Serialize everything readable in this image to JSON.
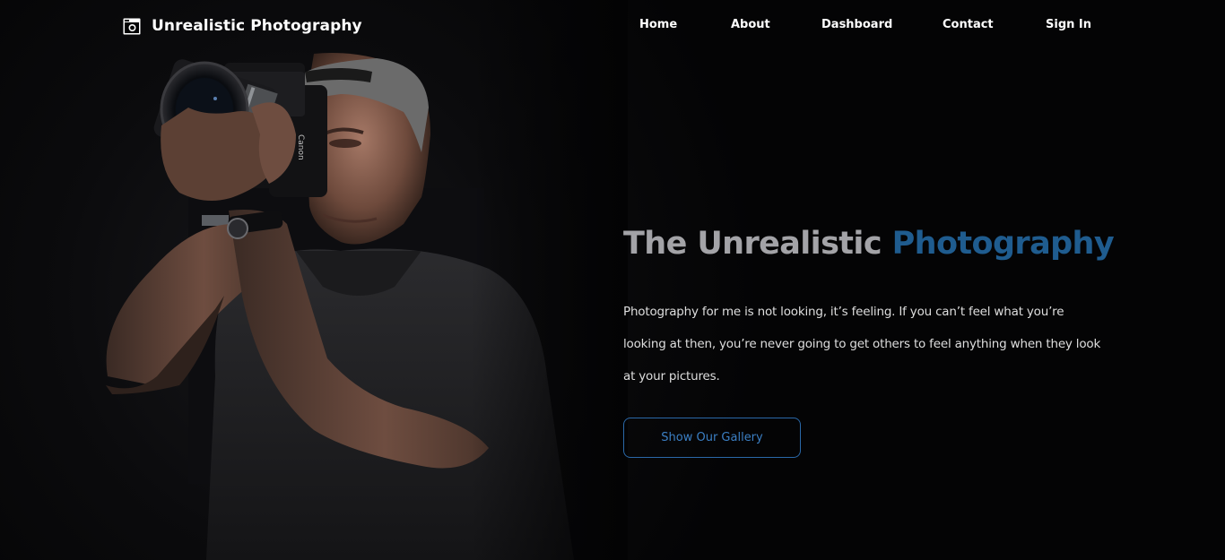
{
  "nav": {
    "brand": "Unrealistic Photography",
    "brand_icon": "camera-icon",
    "links": [
      {
        "label": "Home"
      },
      {
        "label": "About"
      },
      {
        "label": "Dashboard"
      },
      {
        "label": "Contact"
      },
      {
        "label": "Sign In"
      }
    ]
  },
  "hero": {
    "title_main": "The Unrealistic",
    "title_accent": "Photography",
    "description": "Photography for me is not looking, it’s feeling. If you can’t feel what you’re looking at then, you’re never going to get others to feel anything when they look at your pictures.",
    "cta_label": "Show Our Gallery",
    "photo": "photographer-with-camera-image"
  },
  "colors": {
    "background": "#030304",
    "accent": "#1f5c8f",
    "title": "#a3a3a7",
    "button_border": "#2a68a8",
    "button_text": "#3b7fc4"
  }
}
